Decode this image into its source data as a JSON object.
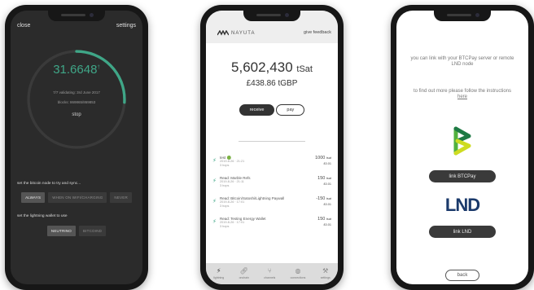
{
  "phone1": {
    "close": "close",
    "settings": "settings",
    "balance": "31.6648",
    "balance_sup": "†",
    "sync_status": "7/7 validating: 3rd June 2017",
    "blocks": "blocks: 869865/869853",
    "stop": "stop",
    "sync_label": "set the bitcoin node to try and sync...",
    "sync_options": [
      "always",
      "when on wifi/charging",
      "never"
    ],
    "sync_selected": "always",
    "wallet_label": "set the lightning wallet to use",
    "wallet_options": [
      "neutrino",
      "bitcoind"
    ],
    "wallet_selected": "neutrino",
    "sync_progress": 0.26,
    "accent": "#3fa687"
  },
  "phone2": {
    "brand": "NAYUTA",
    "feedback": "give feedback",
    "amount": "5,602,430",
    "unit": "tSat",
    "fiat": "£438.86 tGBP",
    "receive": "receive",
    "pay": "pay",
    "transactions": [
      {
        "desc": "test 🟢",
        "date": "2019-8-26 · 21:21",
        "sub": "3 hops",
        "amt": "1000",
        "amt_unit": "tsat",
        "fee": "£0.01"
      },
      {
        "desc": "Read: Marble Refs",
        "date": "2019-8-26 · 21:11",
        "sub": "3 hops",
        "amt": "150",
        "amt_unit": "tsat",
        "fee": "£0.01"
      },
      {
        "desc": "Read: Bitcoin/Satoshi/Lightning Paywall",
        "date": "2019-8-26 · 17:01",
        "sub": "3 hops",
        "amt": "-150",
        "amt_unit": "tsat",
        "fee": "£0.01"
      },
      {
        "desc": "Read: Testing Energy Wallet",
        "date": "2019-8-26 · 17:01",
        "sub": "3 hops",
        "amt": "150",
        "amt_unit": "tsat",
        "fee": "£0.01"
      }
    ],
    "tabs": [
      {
        "label": "lightning",
        "icon": "lightning-icon"
      },
      {
        "label": "onchain",
        "icon": "link-icon"
      },
      {
        "label": "channels",
        "icon": "channels-icon"
      },
      {
        "label": "connections",
        "icon": "globe-icon"
      },
      {
        "label": "settings",
        "icon": "tools-icon"
      }
    ]
  },
  "phone3": {
    "intro": "you can link with your BTCPay server or remote LND node",
    "find_out": "to find out more please follow the instructions",
    "here": "here",
    "link_btcpay": "link BTCPay",
    "link_lnd": "link LND",
    "lnd_logo_text": "LND",
    "back": "back"
  }
}
